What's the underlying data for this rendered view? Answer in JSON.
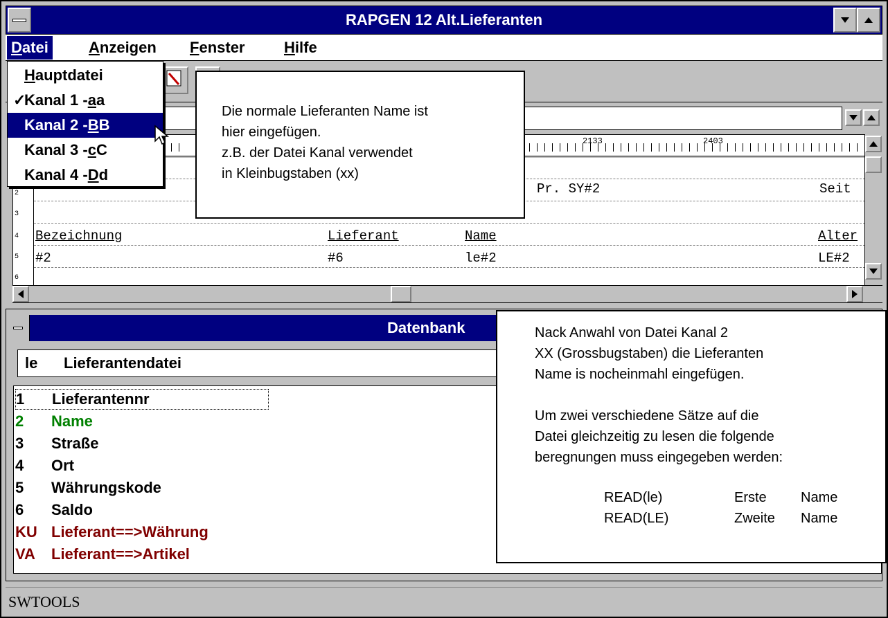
{
  "window": {
    "title": "RAPGEN 12 Alt.Lieferanten"
  },
  "menu": [
    {
      "label": "Datei",
      "underline": "D",
      "rest": "atei"
    },
    {
      "label": "Anzeigen",
      "underline": "A",
      "rest": "nzeigen"
    },
    {
      "label": "Fenster",
      "underline": "F",
      "rest": "enster"
    },
    {
      "label": "Hilfe",
      "underline": "H",
      "rest": "ilfe"
    }
  ],
  "file_menu": {
    "items": [
      {
        "pre": "",
        "u": "H",
        "post": "auptdatei",
        "checked": false,
        "selected": false
      },
      {
        "pre": "Kanal 1 - ",
        "u": "a",
        "post": "a",
        "checked": true,
        "selected": false
      },
      {
        "pre": "Kanal 2 - ",
        "u": "B",
        "post": "B",
        "checked": false,
        "selected": true
      },
      {
        "pre": "Kanal 3 - ",
        "u": "c",
        "post": "C",
        "checked": false,
        "selected": false
      },
      {
        "pre": "Kanal 4 - ",
        "u": "D",
        "post": "d",
        "checked": false,
        "selected": false
      }
    ],
    "check_glyph": "✓"
  },
  "ruler": {
    "labels": [
      "2133",
      "2403"
    ]
  },
  "editor": {
    "line_numbers": [
      "2",
      "3",
      "4",
      "5",
      "6"
    ],
    "line2": {
      "pr": "Pr. SY#2",
      "seite": "Seit"
    },
    "line4": {
      "c1": "Bezeichnung",
      "c2": "Lieferant",
      "c3": "Name",
      "c4": "Alter"
    },
    "line5": {
      "c1": "#2",
      "c2": "#6",
      "c3": "le#2",
      "c4": "LE#2"
    }
  },
  "database": {
    "title": "Datenbank",
    "combo": {
      "code": "le",
      "name": "Lieferantendatei"
    },
    "rows": [
      {
        "num": "1",
        "label": "Lieferantennr",
        "color": "#000000"
      },
      {
        "num": "2",
        "label": "Name",
        "color": "#008000"
      },
      {
        "num": "3",
        "label": "Straße",
        "color": "#000000"
      },
      {
        "num": "4",
        "label": "Ort",
        "color": "#000000"
      },
      {
        "num": "5",
        "label": "Währungskode",
        "color": "#000000"
      },
      {
        "num": "6",
        "label": "Saldo",
        "color": "#000000"
      },
      {
        "num": "KU",
        "label": "Lieferant==>Währung",
        "color": "#800000"
      },
      {
        "num": "VA",
        "label": "Lieferant==>Artikel",
        "color": "#800000"
      }
    ]
  },
  "status": {
    "text": "SWTOOLS"
  },
  "callout1": {
    "lines": [
      "Die normale Lieferanten Name ist",
      "hier eingefügen.",
      "z.B. der Datei Kanal verwendet",
      "in Kleinbugstaben (xx)"
    ]
  },
  "callout2": {
    "lines": [
      "Nack Anwahl von Datei Kanal 2",
      "XX (Grossbugstaben) die Lieferanten",
      "Name is nocheinmahl eingefügen.",
      "",
      "Um zwei verschiedene Sätze auf die",
      "Datei gleichzeitig zu lesen die folgende",
      "beregnungen muss eingegeben werden:"
    ],
    "table": [
      {
        "fn": "READ(le)",
        "which": "Erste",
        "what": "Name"
      },
      {
        "fn": "READ(LE)",
        "which": "Zweite",
        "what": "Name"
      }
    ]
  }
}
